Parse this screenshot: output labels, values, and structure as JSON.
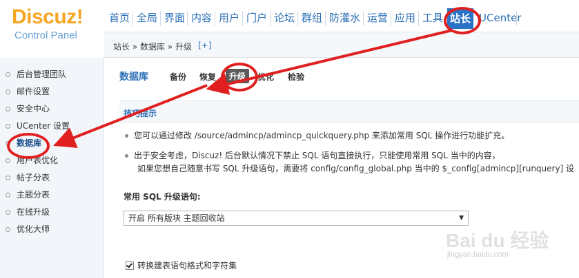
{
  "logo": {
    "brand": "Discuz!",
    "subtitle": "Control Panel"
  },
  "topnav": [
    "首页",
    "全局",
    "界面",
    "内容",
    "用户",
    "门户",
    "论坛",
    "群组",
    "防灌水",
    "运营",
    "应用",
    "工具",
    "站长",
    "UCenter"
  ],
  "topnav_active": "站长",
  "breadcrumb": {
    "path": "站长 » 数据库 » 升级",
    "plus": "[+]"
  },
  "sidebar": [
    "后台管理团队",
    "邮件设置",
    "安全中心",
    "UCenter 设置",
    "数据库",
    "用户表优化",
    "帖子分表",
    "主题分表",
    "在线升级",
    "优化大师"
  ],
  "sidebar_active": "数据库",
  "page_title": "数据库",
  "tabs": [
    "备份",
    "恢复",
    "升级",
    "优化",
    "检验"
  ],
  "tab_active": "升级",
  "tips": {
    "heading": "技巧提示",
    "line1": "您可以通过修改 /source/admincp/admincp_quickquery.php 来添加常用 SQL 操作进行功能扩充。",
    "line2": "出于安全考虑，Discuz! 后台默认情况下禁止 SQL 语句直接执行，只能使用常用 SQL 当中的内容，",
    "line3": "如果您想自己随意书写 SQL 升级语句，需要将 config/config_global.php 当中的 $_config[admincp][runquery] 设"
  },
  "sql_label": "常用 SQL 升级语句:",
  "sql_select_value": "开启 所有版块 主题回收站",
  "checkbox_label": "转换建表语句格式和字符集",
  "checkbox_checked": true,
  "watermark": {
    "logo": "Bai du 经验",
    "site": "jingyan.baidu.com"
  },
  "colors": {
    "accent": "#2b6fb6",
    "logo": "#f6a623",
    "annotation": "#e02020",
    "active_nav": "#2a72c5"
  }
}
